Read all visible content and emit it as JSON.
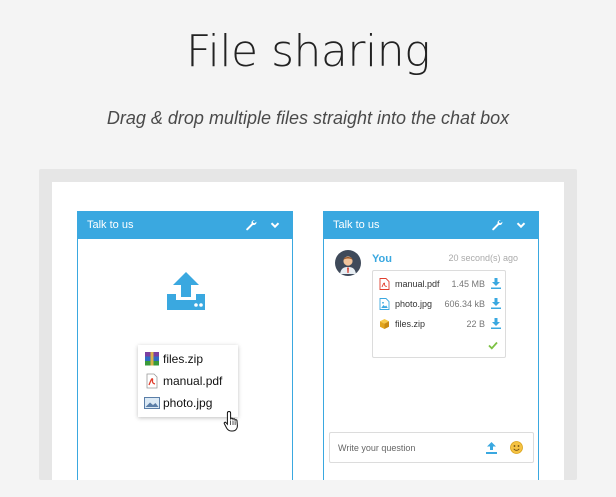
{
  "hero": {
    "title": "File sharing",
    "subtitle": "Drag & drop multiple files straight into the chat box"
  },
  "colors": {
    "accent": "#3aa8e0",
    "success": "#7cc143",
    "pdf": "#e03e2d",
    "emoji": "#f5c242"
  },
  "left_widget": {
    "title": "Talk to us",
    "dragged_files": [
      {
        "name": "files.zip",
        "icon": "archive-icon"
      },
      {
        "name": "manual.pdf",
        "icon": "pdf-file-icon"
      },
      {
        "name": "photo.jpg",
        "icon": "image-file-icon"
      }
    ]
  },
  "right_widget": {
    "title": "Talk to us",
    "message": {
      "author": "You",
      "time": "20 second(s) ago",
      "attachments": [
        {
          "name": "manual.pdf",
          "size": "1.45 MB",
          "icon": "pdf-file-icon"
        },
        {
          "name": "photo.jpg",
          "size": "606.34 kB",
          "icon": "image-file-icon"
        },
        {
          "name": "files.zip",
          "size": "22 B",
          "icon": "archive-icon"
        }
      ]
    },
    "composer": {
      "placeholder": "Write your question",
      "value": ""
    }
  }
}
